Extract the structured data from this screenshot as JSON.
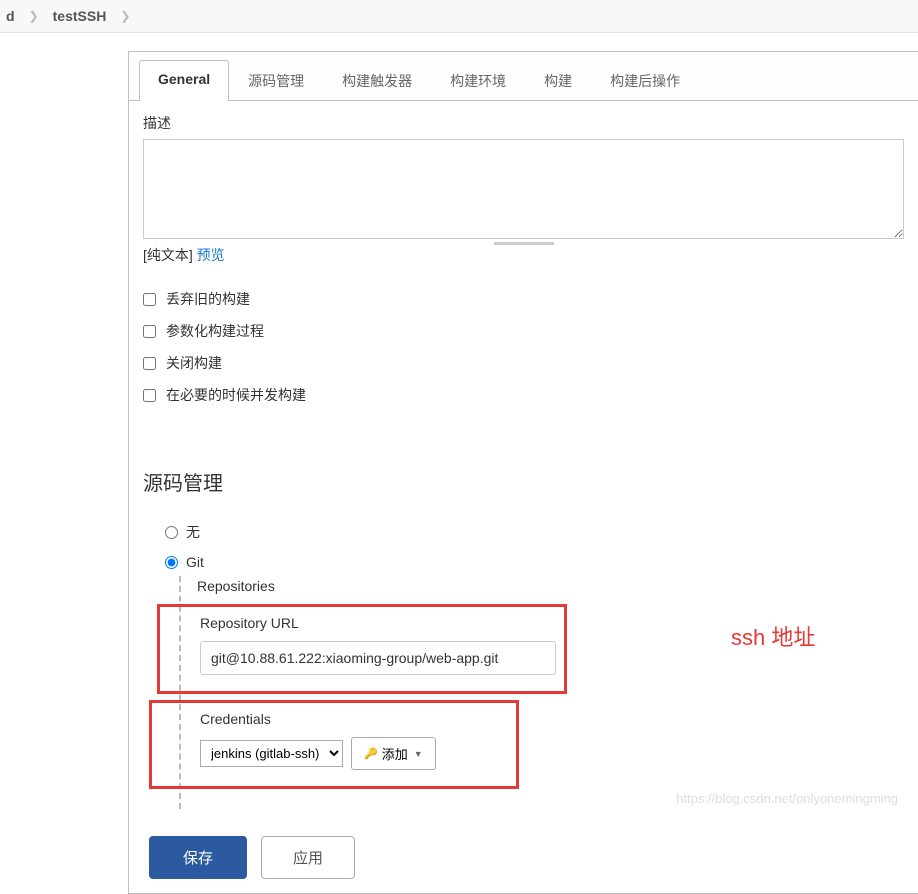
{
  "breadcrumb": {
    "item1": "d",
    "item2": "testSSH"
  },
  "tabs": {
    "general": "General",
    "scm": "源码管理",
    "triggers": "构建触发器",
    "env": "构建环境",
    "build": "构建",
    "post": "构建后操作"
  },
  "general": {
    "desc_label": "描述",
    "plaintext_prefix": "[纯文本] ",
    "preview_link": "预览",
    "opt_discard": "丢弃旧的构建",
    "opt_param": "参数化构建过程",
    "opt_close": "关闭构建",
    "opt_concurrent": "在必要的时候并发构建"
  },
  "scm": {
    "heading": "源码管理",
    "radio_none": "无",
    "radio_git": "Git",
    "repositories_label": "Repositories",
    "repo_url_label": "Repository URL",
    "repo_url_value": "git@10.88.61.222:xiaoming-group/web-app.git",
    "credentials_label": "Credentials",
    "credentials_value": "jenkins (gitlab-ssh)",
    "add_btn": "添加",
    "annotation": "ssh 地址"
  },
  "buttons": {
    "save": "保存",
    "apply": "应用"
  },
  "watermark": "https://blog.csdn.net/onlyonemingming"
}
